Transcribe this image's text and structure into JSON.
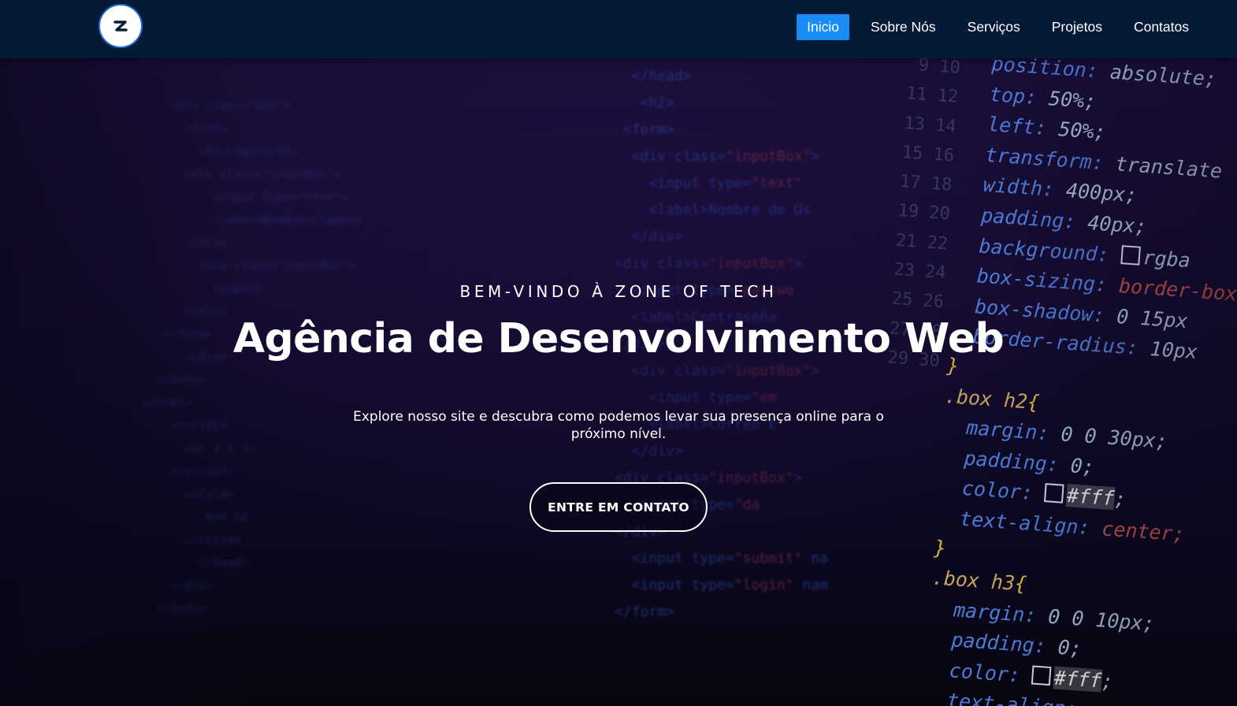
{
  "header": {
    "logo_icon": "z-logo-icon",
    "nav": [
      {
        "label": "Inicio",
        "active": true
      },
      {
        "label": "Sobre Nós",
        "active": false
      },
      {
        "label": "Serviços",
        "active": false
      },
      {
        "label": "Projetos",
        "active": false
      },
      {
        "label": "Contatos",
        "active": false
      }
    ]
  },
  "hero": {
    "eyebrow": "BEM-VINDO À ZONE OF TECH",
    "title": "Agência de Desenvolvimento Web",
    "description": "Explore nosso site e descubra como podemos levar sua presença online para o próximo nível.",
    "cta_label": "ENTRE EM CONTATO"
  },
  "colors": {
    "navbar_bg": "#041a36",
    "active_nav_bg": "#1a8cf5",
    "logo_border": "#1d6fd1",
    "text": "#ffffff"
  }
}
